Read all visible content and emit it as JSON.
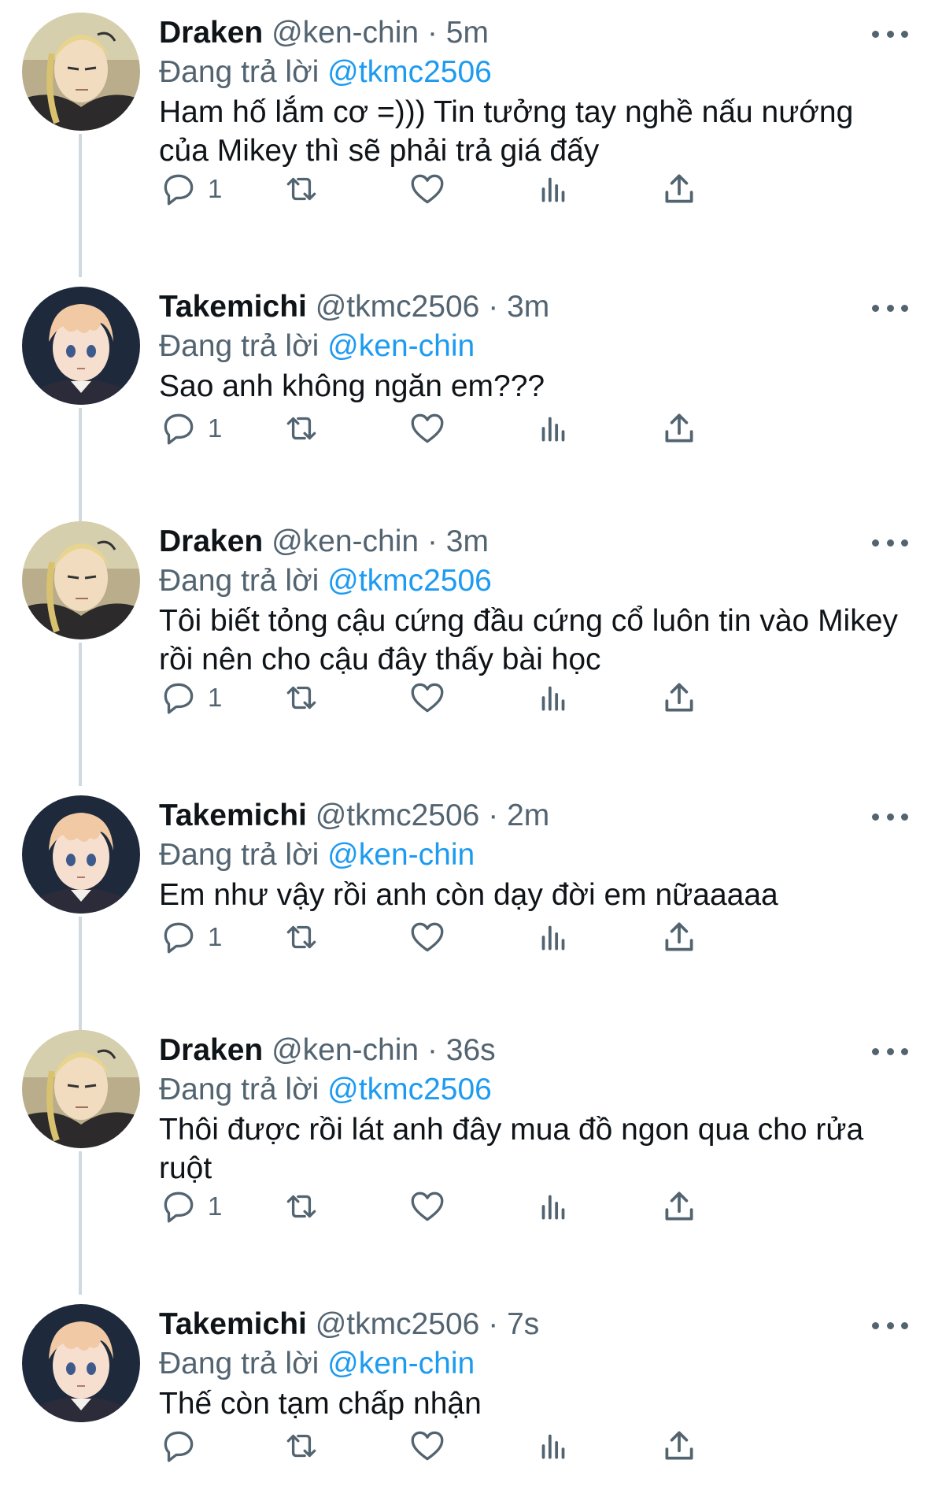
{
  "reply_prefix": "Đang trả lời",
  "tweets": [
    {
      "name": "Draken",
      "handle": "@ken-chin",
      "time": "5m",
      "reply_to": "@tkmc2506",
      "text": "Ham hố lắm cơ =))) Tin tưởng tay nghề nấu nướng của Mikey thì sẽ phải trả giá đấy",
      "replies": "1"
    },
    {
      "name": "Takemichi",
      "handle": "@tkmc2506",
      "time": "3m",
      "reply_to": "@ken-chin",
      "text": "Sao anh không ngăn em???",
      "replies": "1"
    },
    {
      "name": "Draken",
      "handle": "@ken-chin",
      "time": "3m",
      "reply_to": "@tkmc2506",
      "text": "Tôi biết tỏng cậu cứng đầu cứng cổ luôn tin vào Mikey rồi nên cho cậu đây thấy bài học",
      "replies": "1"
    },
    {
      "name": "Takemichi",
      "handle": "@tkmc2506",
      "time": "2m",
      "reply_to": "@ken-chin",
      "text": "Em như vậy rồi anh còn dạy đời em nữaaaaa",
      "replies": "1"
    },
    {
      "name": "Draken",
      "handle": "@ken-chin",
      "time": "36s",
      "reply_to": "@tkmc2506",
      "text": "Thôi được rồi lát anh đây mua đồ ngon qua cho rửa ruột",
      "replies": "1"
    },
    {
      "name": "Takemichi",
      "handle": "@tkmc2506",
      "time": "7s",
      "reply_to": "@ken-chin",
      "text": "Thế còn tạm chấp nhận",
      "replies": ""
    }
  ],
  "colors": {
    "text": "#0f1419",
    "muted": "#536471",
    "link": "#1d9bf0",
    "thread_line": "#cfd9de"
  },
  "icons": {
    "reply": "speech-bubble-icon",
    "retweet": "retweet-icon",
    "like": "heart-icon",
    "views": "bar-chart-icon",
    "share": "share-upload-icon",
    "more": "ellipsis-icon"
  }
}
